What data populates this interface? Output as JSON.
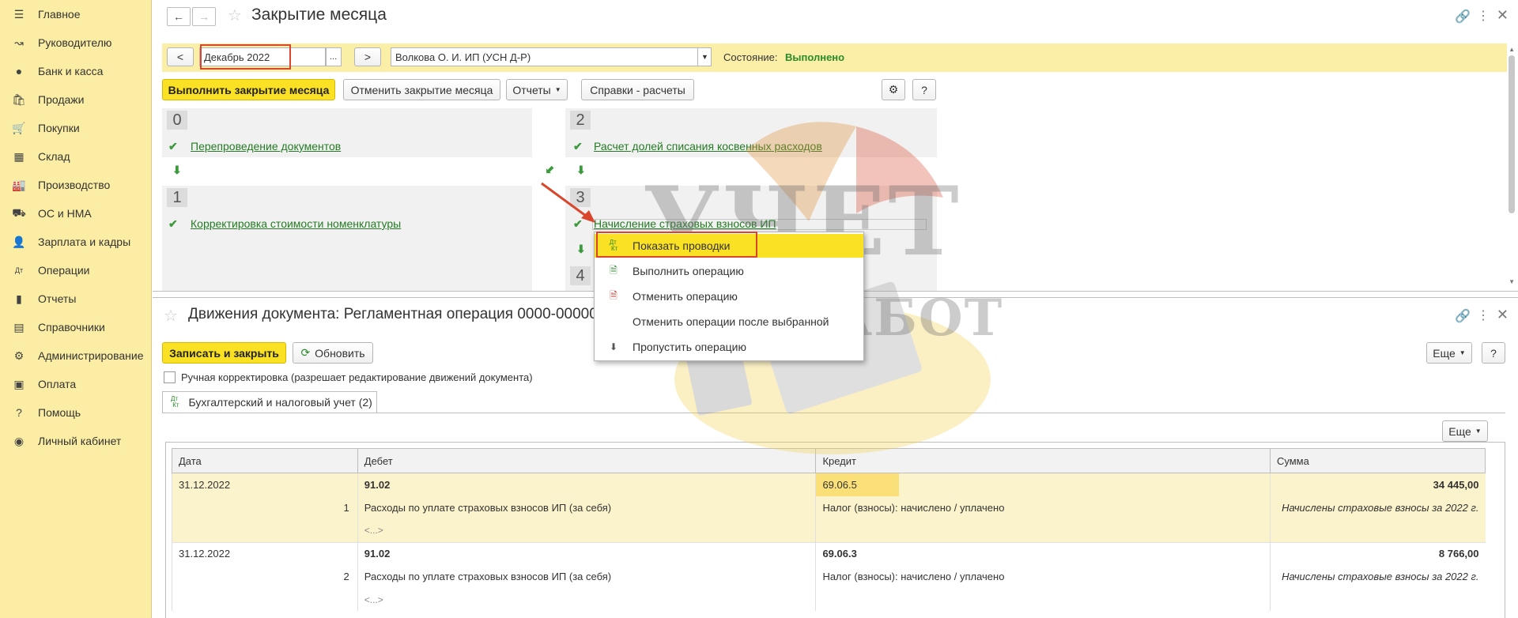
{
  "sidebar": {
    "items": [
      {
        "label": "Главное",
        "icon": "menu-icon"
      },
      {
        "label": "Руководителю",
        "icon": "trend-icon"
      },
      {
        "label": "Банк и касса",
        "icon": "coin-icon"
      },
      {
        "label": "Продажи",
        "icon": "bag-icon"
      },
      {
        "label": "Покупки",
        "icon": "cart-icon"
      },
      {
        "label": "Склад",
        "icon": "warehouse-icon"
      },
      {
        "label": "Производство",
        "icon": "factory-icon"
      },
      {
        "label": "ОС и НМА",
        "icon": "truck-icon"
      },
      {
        "label": "Зарплата и кадры",
        "icon": "person-icon"
      },
      {
        "label": "Операции",
        "icon": "dt-kt-icon"
      },
      {
        "label": "Отчеты",
        "icon": "bar-chart-icon"
      },
      {
        "label": "Справочники",
        "icon": "book-icon"
      },
      {
        "label": "Администрирование",
        "icon": "gear-icon"
      },
      {
        "label": "Оплата",
        "icon": "wallet-icon"
      },
      {
        "label": "Помощь",
        "icon": "question-icon"
      },
      {
        "label": "Личный кабинет",
        "icon": "account-icon"
      }
    ]
  },
  "close_window": {
    "title": "Закрытие месяца",
    "period_prev": "<",
    "period": "Декабрь 2022",
    "period_select": "...",
    "period_next": ">",
    "organization": "Волкова О. И. ИП (УСН Д-Р)",
    "state_label": "Состояние:",
    "state_value": "Выполнено",
    "run_button": "Выполнить закрытие месяца",
    "cancel_button": "Отменить закрытие месяца",
    "reports_button": "Отчеты",
    "refs_button": "Справки - расчеты",
    "help_button": "?",
    "steps": [
      {
        "num": "0",
        "link": "Перепроведение документов"
      },
      {
        "num": "1",
        "link": "Корректировка стоимости номенклатуры"
      },
      {
        "num": "2",
        "link": "Расчет долей списания косвенных расходов"
      },
      {
        "num": "3",
        "link": "Начисление страховых взносов ИП"
      },
      {
        "num": "4",
        "link": ""
      }
    ]
  },
  "context_menu": {
    "items": [
      {
        "label": "Показать проводки",
        "icon": "dt-kt-icon"
      },
      {
        "label": "Выполнить операцию",
        "icon": "run-doc-icon"
      },
      {
        "label": "Отменить операцию",
        "icon": "cancel-doc-icon"
      },
      {
        "label": "Отменить операции после выбранной",
        "icon": ""
      },
      {
        "label": "Пропустить операцию",
        "icon": "skip-down-icon"
      }
    ]
  },
  "movements_window": {
    "title": "Движения документа: Регламентная операция 0000-000003",
    "save_close_button": "Записать и закрыть",
    "refresh_button": "Обновить",
    "more_button": "Еще",
    "help_button": "?",
    "manual_checkbox": "Ручная корректировка (разрешает редактирование движений документа)",
    "tab_label": "Бухгалтерский и налоговый учет (2)",
    "table_more_button": "Еще",
    "columns": [
      "Дата",
      "Дебет",
      "Кредит",
      "Сумма"
    ],
    "rows": [
      {
        "date": "31.12.2022",
        "num": "1",
        "debit": "91.02",
        "debit_desc": "Расходы по уплате страховых взносов ИП (за себя)",
        "debit_extra": "<...>",
        "credit": "69.06.5",
        "credit_desc": "Налог (взносы): начислено / уплачено",
        "sum": "34 445,00",
        "comment": "Начислены страховые взносы за 2022 г."
      },
      {
        "date": "31.12.2022",
        "num": "2",
        "debit": "91.02",
        "debit_desc": "Расходы по уплате страховых взносов ИП (за себя)",
        "debit_extra": "<...>",
        "credit": "69.06.3",
        "credit_desc": "Налог (взносы): начислено / уплачено",
        "sum": "8 766,00",
        "comment": "Начислены страховые взносы за 2022 г."
      }
    ]
  },
  "watermark": {
    "line1": "УЧЕТ",
    "line2": "БЕЗ ЗАБОТ"
  }
}
